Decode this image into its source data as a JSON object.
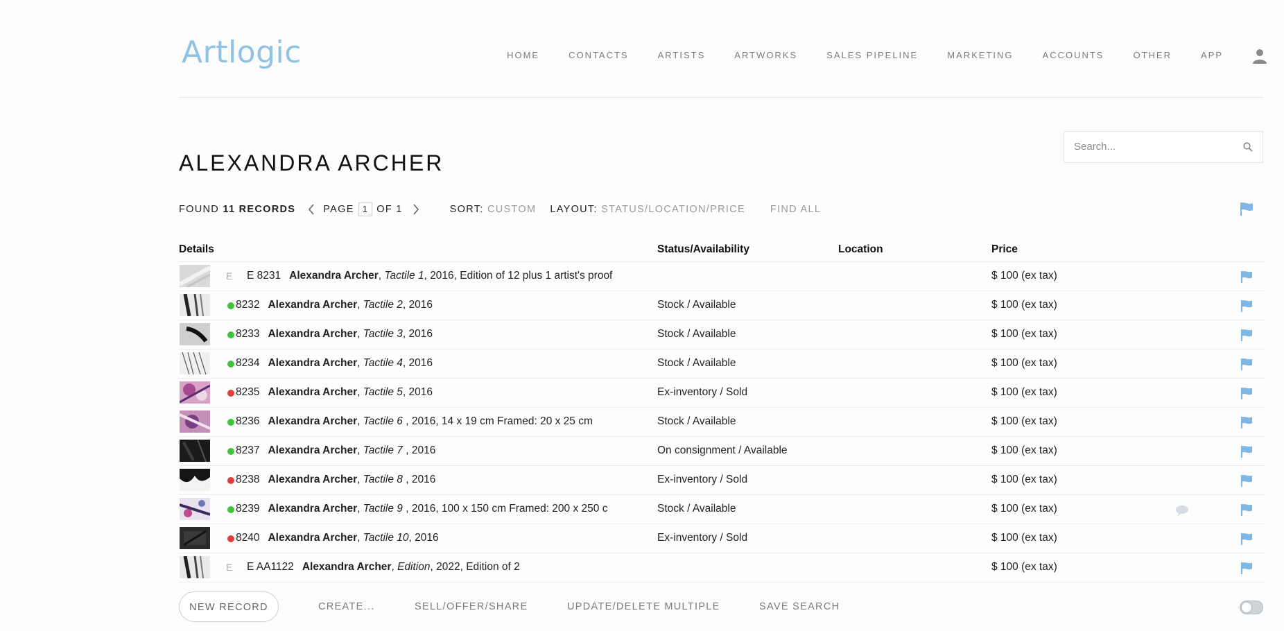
{
  "brand": {
    "logo_text": "Artlogic",
    "accent": "#8fc3e6"
  },
  "nav": {
    "items": [
      "HOME",
      "CONTACTS",
      "ARTISTS",
      "ARTWORKS",
      "SALES PIPELINE",
      "MARKETING",
      "ACCOUNTS",
      "OTHER",
      "APP"
    ],
    "user_icon": "user-icon"
  },
  "page": {
    "title": "ALEXANDRA ARCHER"
  },
  "search": {
    "placeholder": "Search..."
  },
  "toolbar": {
    "found_label": "FOUND",
    "found_count": "11 RECORDS",
    "page_label": "PAGE",
    "page_current": "1",
    "page_of": "OF 1",
    "sort_label": "SORT:",
    "sort_value": "CUSTOM",
    "layout_label": "LAYOUT:",
    "layout_value": "STATUS/LOCATION/PRICE",
    "find_all": "FIND ALL"
  },
  "table": {
    "headers": {
      "details": "Details",
      "status": "Status/Availability",
      "location": "Location",
      "price": "Price"
    },
    "rows": [
      {
        "mark": "E",
        "ref": "E 8231",
        "artist": "Alexandra Archer",
        "title": "Tactile 1",
        "rest": ", 2016, Edition of 12 plus 1 artist's proof",
        "status": "",
        "price": "$ 100 (ex tax)",
        "dot": "",
        "comment": false,
        "thumb": "light"
      },
      {
        "mark": "",
        "ref": "8232",
        "artist": "Alexandra Archer",
        "title": "Tactile 2",
        "rest": ", 2016",
        "status": "Stock / Available",
        "price": "$ 100 (ex tax)",
        "dot": "#3ec43a",
        "comment": false,
        "thumb": "gray-streak"
      },
      {
        "mark": "",
        "ref": "8233",
        "artist": "Alexandra Archer",
        "title": "Tactile 3",
        "rest": ", 2016",
        "status": "Stock / Available",
        "price": "$ 100 (ex tax)",
        "dot": "#3ec43a",
        "comment": false,
        "thumb": "stroke"
      },
      {
        "mark": "",
        "ref": "8234",
        "artist": "Alexandra Archer",
        "title": "Tactile 4",
        "rest": ", 2016",
        "status": "Stock / Available",
        "price": "$ 100 (ex tax)",
        "dot": "#3ec43a",
        "comment": false,
        "thumb": "lines"
      },
      {
        "mark": "",
        "ref": "8235",
        "artist": "Alexandra Archer",
        "title": "Tactile 5",
        "rest": ", 2016",
        "status": "Ex-inventory / Sold",
        "price": "$ 100 (ex tax)",
        "dot": "#e33c3c",
        "comment": false,
        "thumb": "pink"
      },
      {
        "mark": "",
        "ref": "8236",
        "artist": "Alexandra Archer",
        "title": "Tactile 6",
        "rest": " , 2016, 14 x 19 cm Framed: 20 x 25 cm",
        "status": "Stock / Available",
        "price": "$ 100 (ex tax)",
        "dot": "#3ec43a",
        "comment": false,
        "thumb": "pink2"
      },
      {
        "mark": "",
        "ref": "8237",
        "artist": "Alexandra Archer",
        "title": "Tactile 7",
        "rest": " , 2016",
        "status": "On consignment / Available",
        "price": "$ 100 (ex tax)",
        "dot": "#3ec43a",
        "comment": false,
        "thumb": "dark"
      },
      {
        "mark": "",
        "ref": "8238",
        "artist": "Alexandra Archer",
        "title": "Tactile 8",
        "rest": " , 2016",
        "status": "Ex-inventory / Sold",
        "price": "$ 100 (ex tax)",
        "dot": "#e33c3c",
        "comment": false,
        "thumb": "darkwhite"
      },
      {
        "mark": "",
        "ref": "8239",
        "artist": "Alexandra Archer",
        "title": "Tactile 9",
        "rest": " , 2016, 100 x 150 cm Framed: 200 x 250 c",
        "status": "Stock / Available",
        "price": "$ 100 (ex tax)",
        "dot": "#3ec43a",
        "comment": true,
        "thumb": "mixed"
      },
      {
        "mark": "",
        "ref": "8240",
        "artist": "Alexandra Archer",
        "title": "Tactile 10",
        "rest": ", 2016",
        "status": "Ex-inventory / Sold",
        "price": "$ 100 (ex tax)",
        "dot": "#e33c3c",
        "comment": false,
        "thumb": "dark2"
      },
      {
        "mark": "E",
        "ref": "E AA1122",
        "artist": "Alexandra Archer",
        "title": "Edition",
        "rest": ", 2022, Edition of 2",
        "status": "",
        "price": "$ 100 (ex tax)",
        "dot": "",
        "comment": false,
        "thumb": "gray-streak"
      }
    ]
  },
  "footer": {
    "new_record": "NEW RECORD",
    "create": "CREATE...",
    "sell": "SELL/OFFER/SHARE",
    "update": "UPDATE/DELETE MULTIPLE",
    "save_search": "SAVE SEARCH"
  },
  "colors": {
    "flag": "#7fb6e3",
    "available": "#3ec43a",
    "sold": "#e33c3c"
  }
}
